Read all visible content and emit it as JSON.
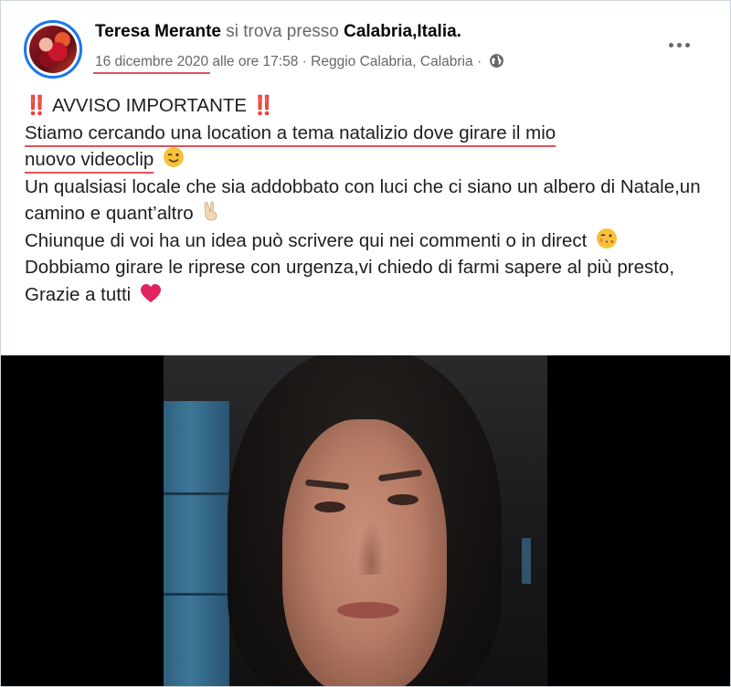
{
  "post": {
    "author_name": "Teresa Merante",
    "author_action": "si trova presso",
    "location": "Calabria,Italia.",
    "date": "16 dicembre 2020",
    "time_text": "alle ore 17:58",
    "separator": "·",
    "place": "Reggio Calabria, Calabria",
    "privacy_icon": "globe-icon",
    "more_icon": "more-options-icon"
  },
  "text": {
    "line1": "‼️ AVVISO IMPORTANTE ‼️",
    "line2a": "Stiamo cercando una location a tema natalizio dove girare il mio",
    "line2b": "nuovo videoclip",
    "line3": "Un qualsiasi locale che sia addobbato con luci che ci siano un albero di Natale,un camino e quant’altro",
    "line4": "Chiunque di voi ha un idea può scrivere qui nei commenti o in direct",
    "line5": "Dobbiamo girare le riprese con urgenza,vi chiedo di farmi sapere al più presto, Grazie a tutti"
  },
  "colors": {
    "accent": "#1877f2",
    "underline": "#e0525c",
    "alert_red": "#e0245e"
  }
}
